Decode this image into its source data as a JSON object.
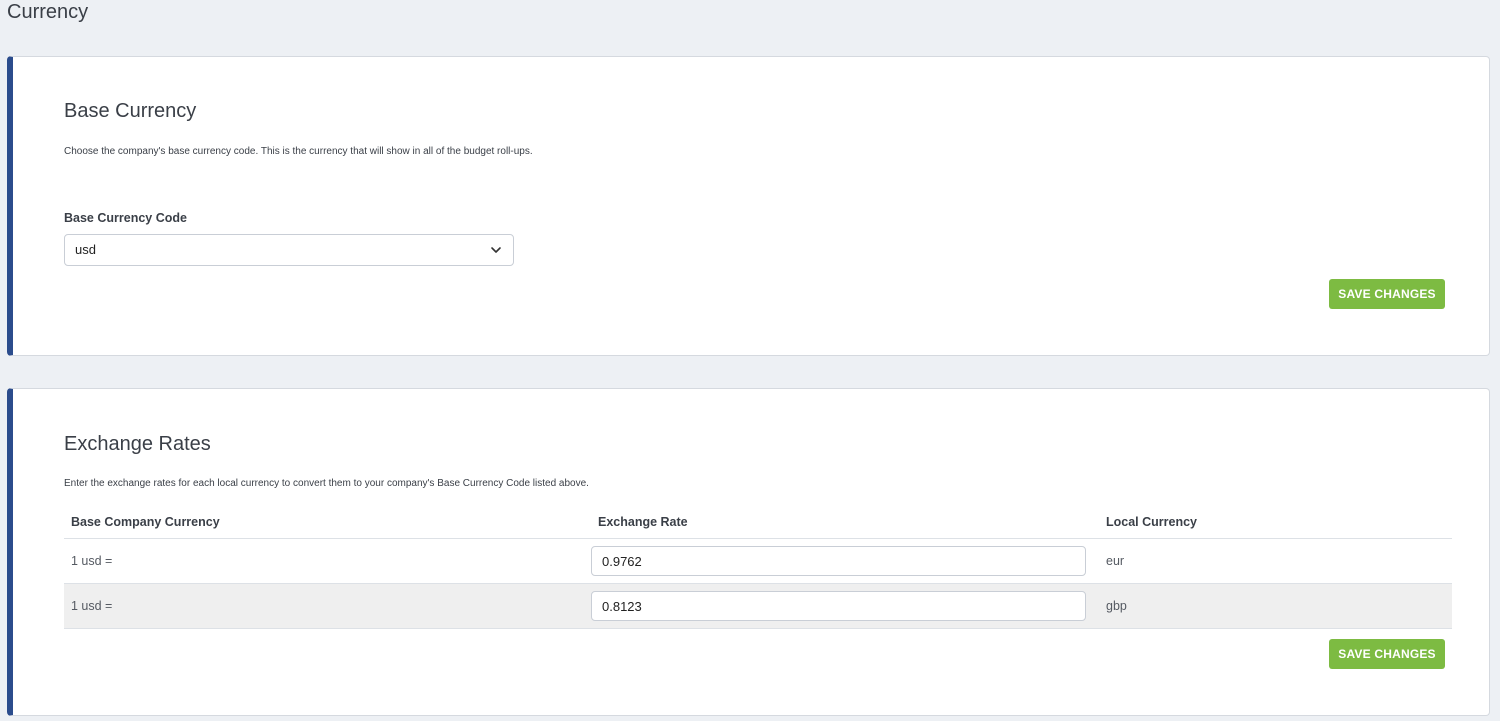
{
  "page": {
    "title": "Currency"
  },
  "base_currency": {
    "title": "Base Currency",
    "description": "Choose the company's base currency code. This is the currency that will show in all of the budget roll-ups.",
    "field_label": "Base Currency Code",
    "selected_value": "usd",
    "save_label": "SAVE CHANGES"
  },
  "exchange_rates": {
    "title": "Exchange Rates",
    "description": "Enter the exchange rates for each local currency to convert them to your company's Base Currency Code listed above.",
    "columns": [
      "Base Company Currency",
      "Exchange Rate",
      "Local Currency"
    ],
    "rows": [
      {
        "base": "1 usd =",
        "rate": "0.9762",
        "local": "eur"
      },
      {
        "base": "1 usd =",
        "rate": "0.8123",
        "local": "gbp"
      }
    ],
    "save_label": "SAVE CHANGES"
  },
  "colors": {
    "accent_border": "#2b4c8c",
    "save_button": "#7dbb42",
    "page_background": "#edf0f4"
  },
  "icons": {
    "select_chevron": "chevron-down-icon"
  }
}
